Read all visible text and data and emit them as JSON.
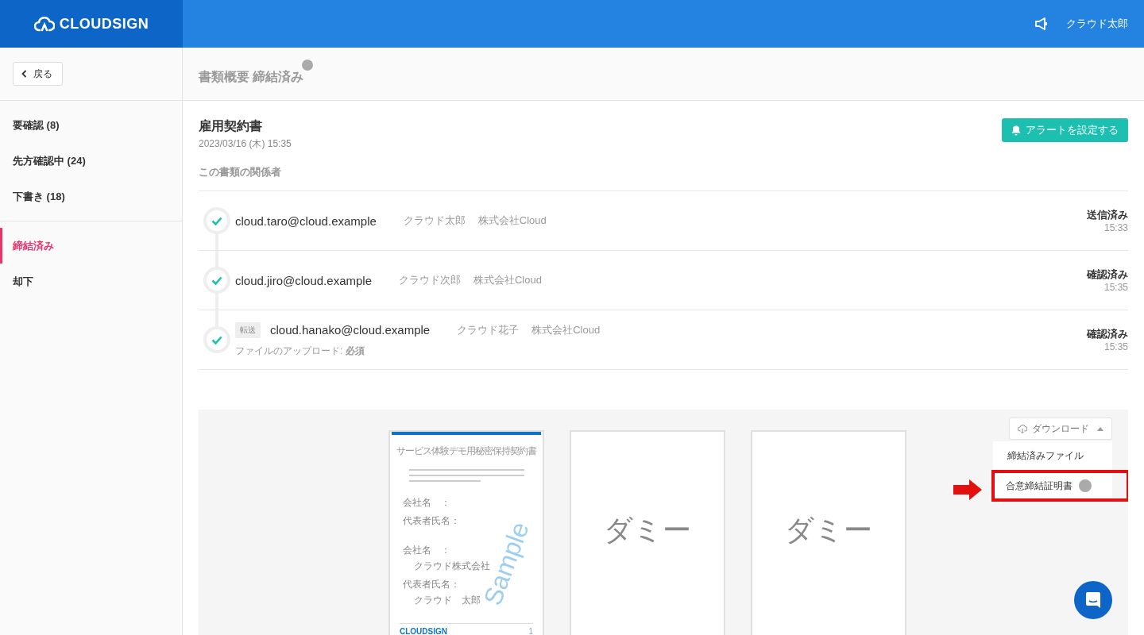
{
  "header": {
    "logo": "CLOUDSIGN",
    "user": "クラウド太郎"
  },
  "sidebar": {
    "back": "戻る",
    "groups": [
      [
        {
          "label": "要確認 (8)",
          "selected": false
        },
        {
          "label": "先方確認中 (24)",
          "selected": false
        },
        {
          "label": "下書き (18)",
          "selected": false
        }
      ],
      [
        {
          "label": "締結済み",
          "selected": true
        },
        {
          "label": "却下",
          "selected": false
        }
      ]
    ]
  },
  "main": {
    "page_title": "書類概要 締結済み",
    "document": {
      "title": "雇用契約書",
      "date": "2023/03/16 (木) 15:35"
    },
    "alert_button": "アラートを設定する",
    "participants_heading": "この書類の関係者",
    "participants": [
      {
        "email": "cloud.taro@cloud.example",
        "name": "クラウド太郎",
        "company": "株式会社Cloud",
        "status": "送信済み",
        "time": "15:33",
        "done": true
      },
      {
        "email": "cloud.jiro@cloud.example",
        "name": "クラウド次郎",
        "company": "株式会社Cloud",
        "status": "確認済み",
        "time": "15:35",
        "done": true
      },
      {
        "email": "cloud.hanako@cloud.example",
        "badge": "転送",
        "name": "クラウド花子",
        "company": "株式会社Cloud",
        "note_label": "ファイルのアップロード:",
        "note_value": "必須",
        "status": "確認済み",
        "time": "15:35",
        "done": true
      }
    ]
  },
  "preview": {
    "download_button": "ダウンロード",
    "menu": [
      {
        "label": "締結済みファイル",
        "help": false,
        "highlighted": false
      },
      {
        "label": "合意締結証明書",
        "help": true,
        "highlighted": true
      }
    ],
    "pages": [
      {
        "kind": "document",
        "title": "サービス体験デモ用秘密保持契約書",
        "watermark": "Sample",
        "fields": [
          {
            "label": "会社名　："
          },
          {
            "label": "代表者氏名："
          },
          {
            "label": "会社名　：",
            "value": "クラウド株式会社"
          },
          {
            "label": "代表者氏名：",
            "value": "クラウド　太郎"
          }
        ],
        "footer_logo": "CLOUDSIGN",
        "page_number": "1"
      },
      {
        "kind": "dummy",
        "text": "ダミー"
      },
      {
        "kind": "dummy",
        "text": "ダミー"
      }
    ]
  }
}
